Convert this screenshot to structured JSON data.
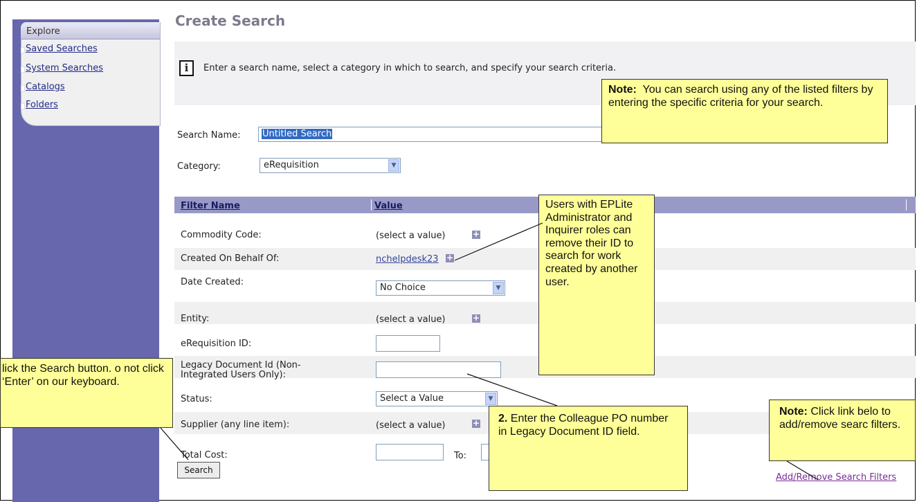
{
  "sidebar": {
    "header": "Explore",
    "items": [
      {
        "label": "Saved Searches"
      },
      {
        "label": "System Searches"
      },
      {
        "label": "Catalogs"
      },
      {
        "label": "Folders"
      }
    ]
  },
  "page": {
    "title": "Create Search",
    "info_text": "Enter a search name, select a category in which to search, and specify your search criteria."
  },
  "form": {
    "search_name_label": "Search Name:",
    "search_name_value": "Untitled Search",
    "category_label": "Category:",
    "category_value": "eRequisition"
  },
  "table": {
    "headers": [
      "Filter Name",
      "Value"
    ],
    "rows": [
      {
        "label": "Commodity Code:",
        "value": "(select a value)"
      },
      {
        "label": "Created On Behalf Of:",
        "value": "nchelpdesk23"
      },
      {
        "label": "Date Created:",
        "value": "No Choice"
      },
      {
        "label": "Entity:",
        "value": "(select a value)"
      },
      {
        "label": "eRequisition ID:",
        "value": ""
      },
      {
        "label": "Legacy Document Id (Non-",
        "label2": "Integrated Users Only):",
        "value": ""
      },
      {
        "label": "Status:",
        "value": "Select a Value"
      },
      {
        "label": "Supplier (any line item):",
        "value": "(select a value)"
      },
      {
        "label": "Total Cost:",
        "value": "",
        "to_label": "To:"
      }
    ]
  },
  "buttons": {
    "search": "Search",
    "add_remove": "Add/Remove Search Filters"
  },
  "callouts": {
    "note_top_bold": "Note:",
    "note_top_text": "You can search using any of the listed filters by entering the specific criteria for your search.",
    "users_text": "Users with EPLite Administrator and Inquirer roles can remove their ID to search for work created by another user.",
    "left_text": "lick the Search button. o not click ‘Enter’ on our keyboard.",
    "colleague_bold": "2.",
    "colleague_text": "Enter the Colleague PO number in Legacy Document ID field.",
    "note_right_bold": "Note:",
    "note_right_text": "Click link belo to add/remove searc filters."
  }
}
